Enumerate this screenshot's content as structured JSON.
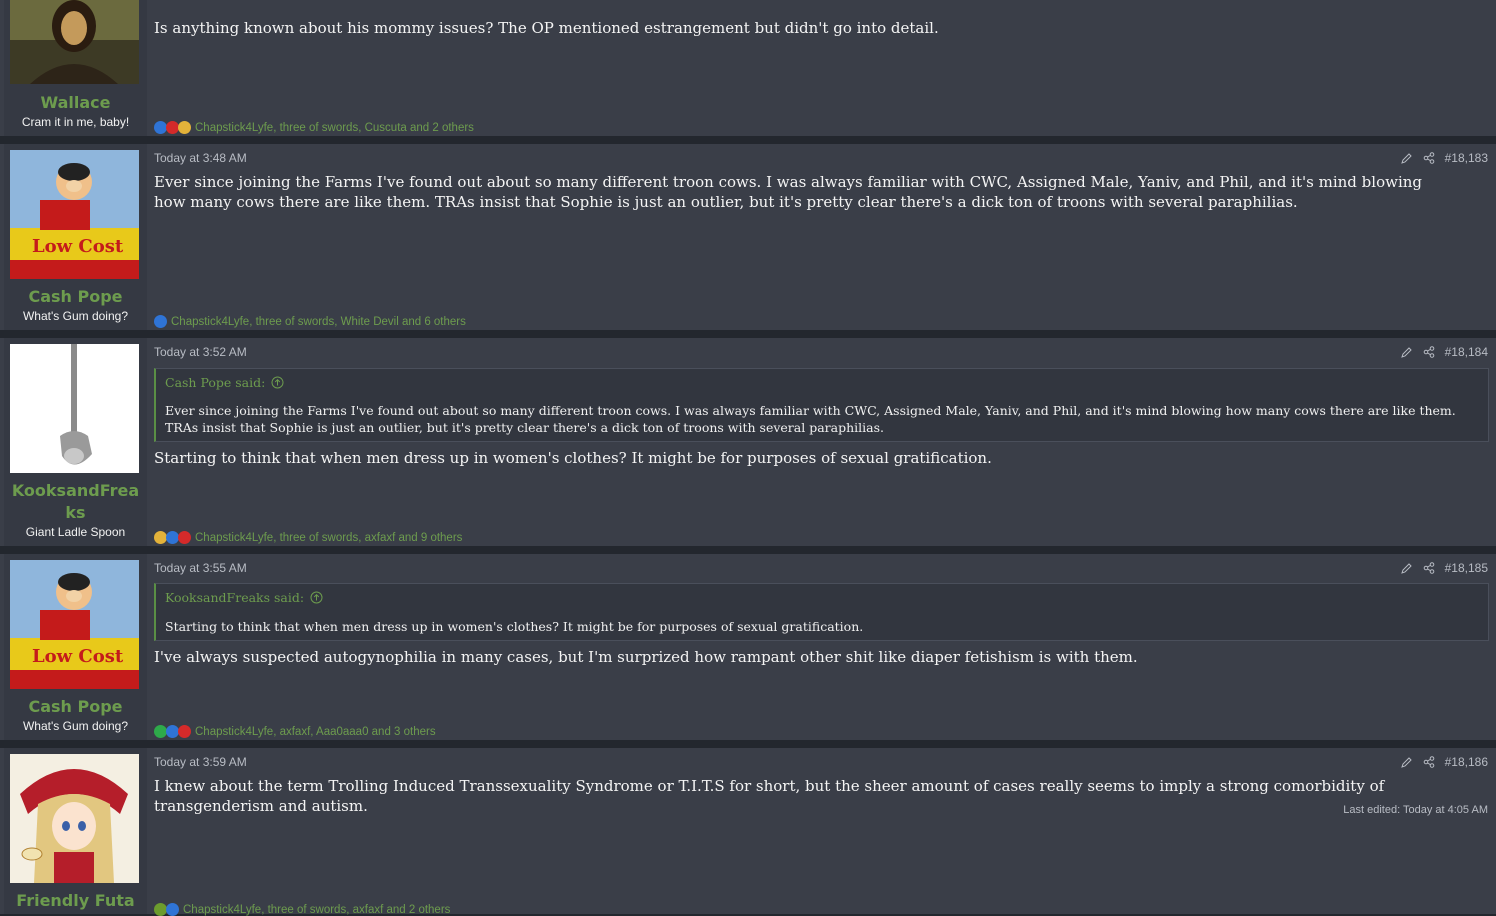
{
  "posts": [
    {
      "username": "Wallace",
      "user_title": "Cram it in me, baby!",
      "timestamp": "",
      "post_number": "",
      "body": "Is anything known about his mommy issues? The OP mentioned estrangement but didn't go into detail.",
      "reactions": "Chapstick4Lyfe, three of swords, Cuscuta and 2 others",
      "reaction_icons": [
        "like",
        "heart",
        "thinking"
      ]
    },
    {
      "username": "Cash Pope",
      "user_title": "What's Gum doing?",
      "timestamp": "Today at 3:48 AM",
      "post_number": "#18,183",
      "body": "Ever since joining the Farms I've found out about so many different troon cows. I was always familiar with CWC, Assigned Male, Yaniv, and Phil, and it's mind blowing how many cows there are like them. TRAs insist that Sophie is just an outlier, but it's pretty clear there's a dick ton of troons with several paraphilias.",
      "reactions": "Chapstick4Lyfe, three of swords, White Devil and 6 others",
      "reaction_icons": [
        "like"
      ]
    },
    {
      "username": "KooksandFreaks",
      "user_title": "Giant Ladle Spoon",
      "timestamp": "Today at 3:52 AM",
      "post_number": "#18,184",
      "quote_author": "Cash Pope said:",
      "quote_body": "Ever since joining the Farms I've found out about so many different troon cows. I was always familiar with CWC, Assigned Male, Yaniv, and Phil, and it's mind blowing how many cows there are like them. TRAs insist that Sophie is just an outlier, but it's pretty clear there's a dick ton of troons with several paraphilias.",
      "body": "Starting to think that when men dress up in women's clothes? It might be for purposes of sexual gratification.",
      "reactions": "Chapstick4Lyfe, three of swords, axfaxf and 9 others",
      "reaction_icons": [
        "thinking",
        "like",
        "heart"
      ]
    },
    {
      "username": "Cash Pope",
      "user_title": "What's Gum doing?",
      "timestamp": "Today at 3:55 AM",
      "post_number": "#18,185",
      "quote_author": "KooksandFreaks said:",
      "quote_body": "Starting to think that when men dress up in women's clothes? It might be for purposes of sexual gratification.",
      "body": "I've always suspected autogynophilia in many cases, but I'm surprized how rampant other shit like diaper fetishism is with them.",
      "reactions": "Chapstick4Lyfe, axfaxf, Aaa0aaa0 and 3 others",
      "reaction_icons": [
        "check",
        "like",
        "heart"
      ]
    },
    {
      "username": "Friendly Futa",
      "user_title": "",
      "timestamp": "Today at 3:59 AM",
      "post_number": "#18,186",
      "body": "I knew about the term Trolling Induced Transsexuality Syndrome or T.I.T.S for short, but the sheer amount of cases really seems to imply a strong comorbidity of transgenderism and autism.",
      "edited": "Last edited: Today at 4:05 AM",
      "reactions": "Chapstick4Lyfe, three of swords, axfaxf and 2 others",
      "reaction_icons": [
        "clown",
        "like"
      ]
    }
  ]
}
